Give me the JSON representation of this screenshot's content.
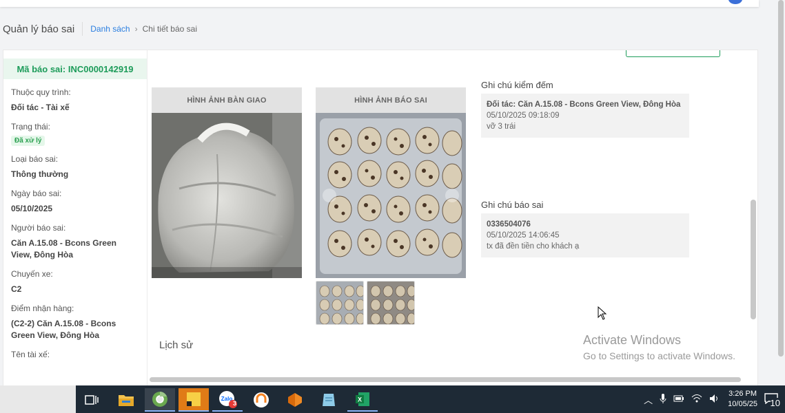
{
  "header": {
    "module_title": "Quản lý báo sai",
    "breadcrumb": {
      "parent": "Danh sách",
      "current": "Chi tiết báo sai"
    }
  },
  "sidebar": {
    "incident_label": "Mã báo sai: INC0000142919",
    "fields": [
      {
        "label": "Thuộc quy trình:",
        "value": "Đối tác - Tài xế"
      },
      {
        "label": "Trạng thái:",
        "badge": "Đã xử lý"
      },
      {
        "label": "Loại báo sai:",
        "value": "Thông thường"
      },
      {
        "label": "Ngày báo sai:",
        "value": "05/10/2025"
      },
      {
        "label": "Người báo sai:",
        "value": "Căn A.15.08 - Bcons Green View, Đông Hòa"
      },
      {
        "label": "Chuyến xe:",
        "value": "C2"
      },
      {
        "label": "Điểm nhận hàng:",
        "value": "(C2-2) Căn A.15.08 - Bcons Green View, Đông Hòa"
      },
      {
        "label": "Tên tài xế:",
        "value": ""
      }
    ]
  },
  "images": {
    "handover_title": "HÌNH ẢNH BÀN GIAO",
    "report_title": "HÌNH ẢNH BÁO SAI"
  },
  "notes": {
    "count_title": "Ghi chú kiểm đếm",
    "count_note": {
      "author": "Đối tác: Căn A.15.08 - Bcons Green View, Đông Hòa",
      "time": "05/10/2025 09:18:09",
      "text": "vỡ 3 trái"
    },
    "report_title": "Ghi chú báo sai",
    "report_note": {
      "author": "0336504076",
      "time": "05/10/2025 14:06:45",
      "text": "tx đã đền tiền cho khách ạ"
    }
  },
  "history_title": "Lịch sử",
  "watermark": {
    "line1": "Activate Windows",
    "line2": "Go to Settings to activate Windows."
  },
  "taskbar": {
    "time": "3:26 PM",
    "date": "10/05/25",
    "zalo_badge": "3",
    "notification_count": "10"
  },
  "colors": {
    "accent_green": "#1d9c5a",
    "link_blue": "#2a7ee0",
    "header_bg": "#e9f6ee"
  }
}
